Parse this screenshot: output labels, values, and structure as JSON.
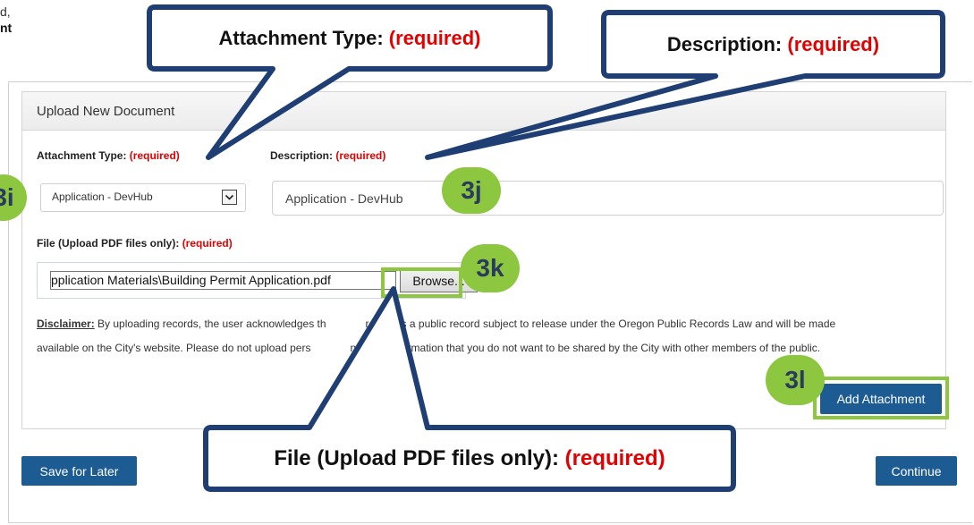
{
  "cut_text": {
    "line1": "d,",
    "line2": "nt"
  },
  "panel": {
    "title": "Upload New Document"
  },
  "fields": {
    "attachment_type": {
      "label": "Attachment Type:",
      "required": "(required)",
      "value": "Application - DevHub"
    },
    "description": {
      "label": "Description:",
      "required": "(required)",
      "value": "Application - DevHub"
    },
    "file": {
      "label": "File (Upload PDF files only):",
      "required": "(required)",
      "value": "pplication Materials\\Building Permit Application.pdf",
      "browse_label": "Browse..."
    }
  },
  "disclaimer": {
    "label": "Disclaimer:",
    "line1a": "By uploading records, the user acknowledges th",
    "line1b": "record is a public record subject to release under the Oregon Public Records Law and will be made",
    "line2a": "available on the City's website. Please do not upload pers",
    "line2b": "ntifiable information that you do not want to be shared by the City with other members of the public."
  },
  "buttons": {
    "add_attachment": "Add Attachment",
    "save_for_later": "Save for Later",
    "continue": "Continue"
  },
  "badges": {
    "b1": "3i",
    "b2": "3j",
    "b3": "3k",
    "b4": "3l"
  },
  "callouts": {
    "attachment": {
      "label": "Attachment Type:",
      "required": "(required)"
    },
    "description": {
      "label": "Description:",
      "required": "(required)"
    },
    "file": {
      "label": "File (Upload PDF files only):",
      "required": "(required)"
    }
  },
  "colors": {
    "accent_green": "#8dc63f",
    "button_blue": "#1d5c93",
    "callout_blue": "#1f3f74",
    "required_red": "#e30000"
  }
}
